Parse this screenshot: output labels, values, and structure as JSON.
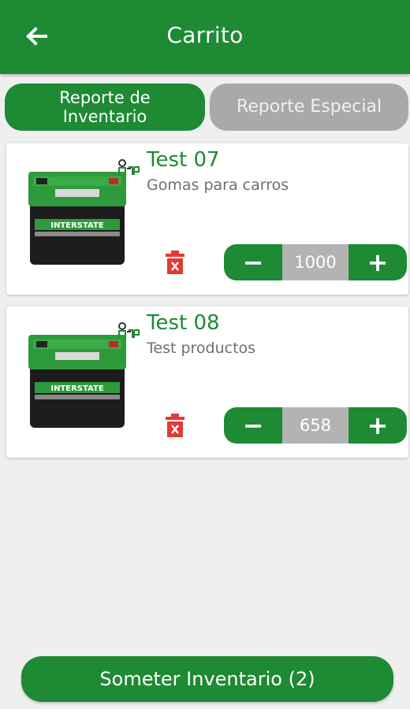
{
  "header": {
    "title": "Carrito",
    "back_icon": "arrow-left-icon"
  },
  "tabs": [
    {
      "label": "Reporte de Inventario",
      "active": true
    },
    {
      "label": "Reporte Especial",
      "active": false
    }
  ],
  "cart": {
    "items": [
      {
        "name": "Test 07",
        "description": "Gomas para carros",
        "quantity": "1000",
        "battery_label": "INTERSTATE"
      },
      {
        "name": "Test 08",
        "description": "Test productos",
        "quantity": "658",
        "battery_label": "INTERSTATE"
      }
    ],
    "minus_label": "−",
    "plus_label": "+"
  },
  "footer": {
    "submit_label": "Someter Inventario (2)"
  },
  "colors": {
    "primary": "#1e8a34",
    "inactive_tab": "#a9a9a9",
    "delete": "#e53935"
  }
}
